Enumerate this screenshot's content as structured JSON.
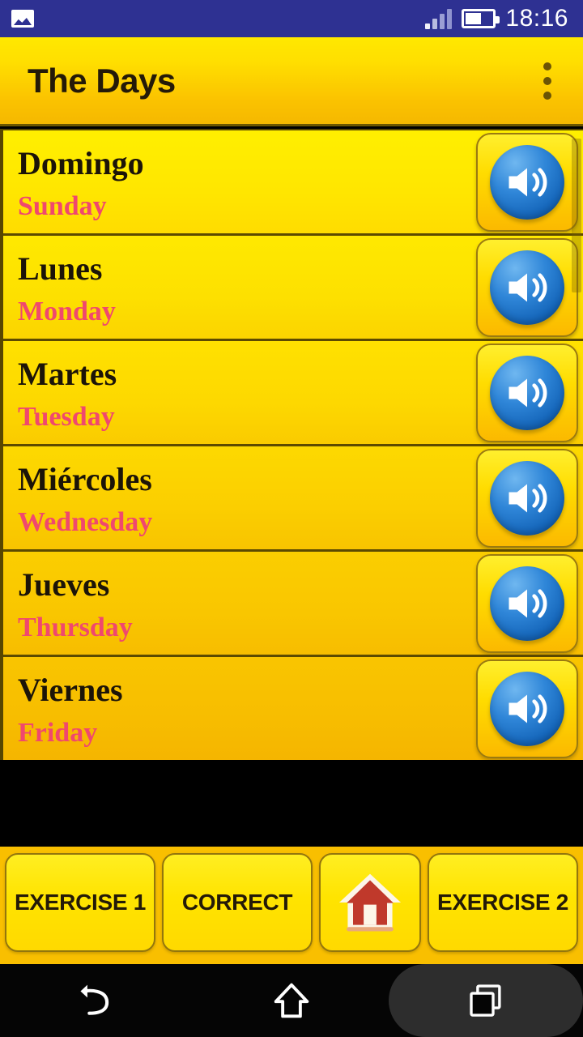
{
  "status_bar": {
    "notification_icon": "image-icon",
    "signal_icon": "signal-bars-icon",
    "battery_icon": "battery-icon",
    "time": "18:16",
    "background_color": "#2e3192"
  },
  "title_bar": {
    "title": "The Days",
    "overflow_icon": "overflow-menu-icon",
    "accent_color": "#ffdf00"
  },
  "list": {
    "speaker_icon": "speaker-icon",
    "rows": [
      {
        "spanish": "Domingo",
        "english": "Sunday"
      },
      {
        "spanish": "Lunes",
        "english": "Monday"
      },
      {
        "spanish": "Martes",
        "english": "Tuesday"
      },
      {
        "spanish": "Miércoles",
        "english": "Wednesday"
      },
      {
        "spanish": "Jueves",
        "english": "Thursday"
      },
      {
        "spanish": "Viernes",
        "english": "Friday"
      }
    ],
    "spanish_text_color": "#1c1408",
    "english_text_color": "#f0486e"
  },
  "button_bar": {
    "exercise_1_label": "EXERCISE 1",
    "correct_label": "CORRECT",
    "home_icon": "home-icon",
    "exercise_2_label": "EXERCISE 2"
  },
  "nav_bar": {
    "back_icon": "back-icon",
    "home_icon": "home-outline-icon",
    "recents_icon": "recents-icon"
  }
}
